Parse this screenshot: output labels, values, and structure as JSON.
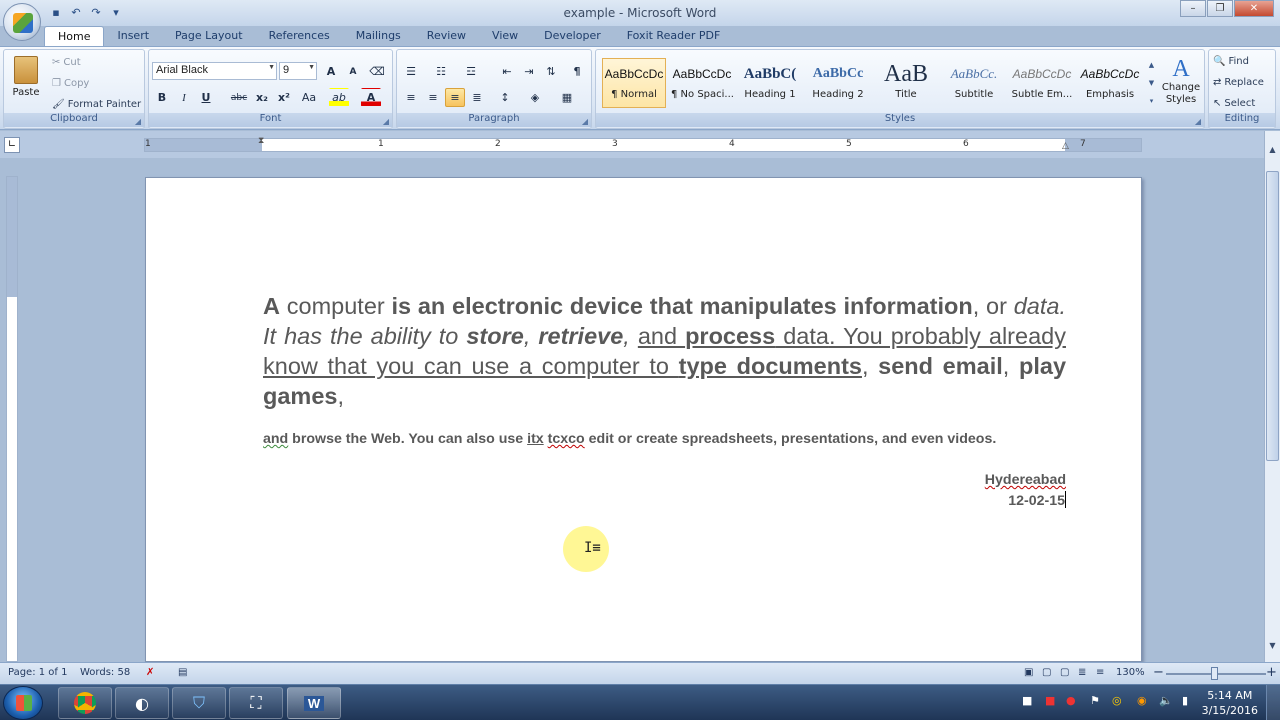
{
  "window": {
    "title": "example - Microsoft Word",
    "controls": {
      "minimize": "–",
      "restore": "❐",
      "close": "✕"
    }
  },
  "qat": {
    "icons": [
      "save-icon",
      "undo-icon",
      "redo-icon",
      "customize-icon"
    ],
    "glyphs": [
      "▪",
      "↶",
      "↷",
      "▾"
    ]
  },
  "tabs": [
    "Home",
    "Insert",
    "Page Layout",
    "References",
    "Mailings",
    "Review",
    "View",
    "Developer",
    "Foxit Reader PDF"
  ],
  "active_tab": "Home",
  "clipboard": {
    "label": "Clipboard",
    "paste": "Paste",
    "cut": "Cut",
    "copy": "Copy",
    "format_painter": "Format Painter"
  },
  "font": {
    "label": "Font",
    "name": "Arial Black",
    "size": "9",
    "grow": "A",
    "shrink": "A",
    "bold": "B",
    "italic": "I",
    "underline": "U",
    "strike": "abc",
    "subscript": "x₂",
    "superscript": "x²",
    "change_case": "Aa",
    "highlight": "ab",
    "font_color": "A"
  },
  "paragraph": {
    "label": "Paragraph"
  },
  "styles": {
    "label": "Styles",
    "items": [
      {
        "sample": "AaBbCcDc",
        "name": "¶ Normal"
      },
      {
        "sample": "AaBbCcDc",
        "name": "¶ No Spaci..."
      },
      {
        "sample": "AaBbC(",
        "name": "Heading 1"
      },
      {
        "sample": "AaBbCc",
        "name": "Heading 2"
      },
      {
        "sample": "AaB",
        "name": "Title"
      },
      {
        "sample": "AaBbCc.",
        "name": "Subtitle"
      },
      {
        "sample": "AaBbCcDc",
        "name": "Subtle Em..."
      },
      {
        "sample": "AaBbCcDc",
        "name": "Emphasis"
      }
    ],
    "change_styles": "Change Styles"
  },
  "editing": {
    "label": "Editing",
    "find": "Find",
    "replace": "Replace",
    "select": "Select"
  },
  "ruler": {
    "numbers": [
      "1",
      "1",
      "2",
      "3",
      "4",
      "5",
      "6",
      "7"
    ]
  },
  "document": {
    "p1": {
      "s1": "A",
      "s2": " computer ",
      "s3": "is an electronic device that manipulates information",
      "s4": ", or ",
      "s5": "data. It has the ability to ",
      "s6": "store",
      "s7": ", ",
      "s8": "retrieve",
      "s9": ", ",
      "s10": "and ",
      "s11": "process",
      "s12": " data",
      "s13": ". You probably already know that you can use a computer to ",
      "s14": "type documents",
      "s15": ", ",
      "s16": "send email",
      "s17": ", ",
      "s18": "play games",
      "s19": ","
    },
    "p2": {
      "t1": " ",
      "t2": "and",
      "t3": " browse the Web. You can also use ",
      "t4": "itx",
      "t5": " ",
      "t6": "tcxco",
      "t7": " edit or create spreadsheets, presentations, and even videos."
    },
    "city": "Hydereabad",
    "date": "12-02-15"
  },
  "status": {
    "page": "Page: 1 of 1",
    "words": "Words: 58",
    "zoom": "130%",
    "zoom_out": "−",
    "zoom_in": "+"
  },
  "clock": {
    "time": "5:14 AM",
    "date": "3/15/2016"
  }
}
